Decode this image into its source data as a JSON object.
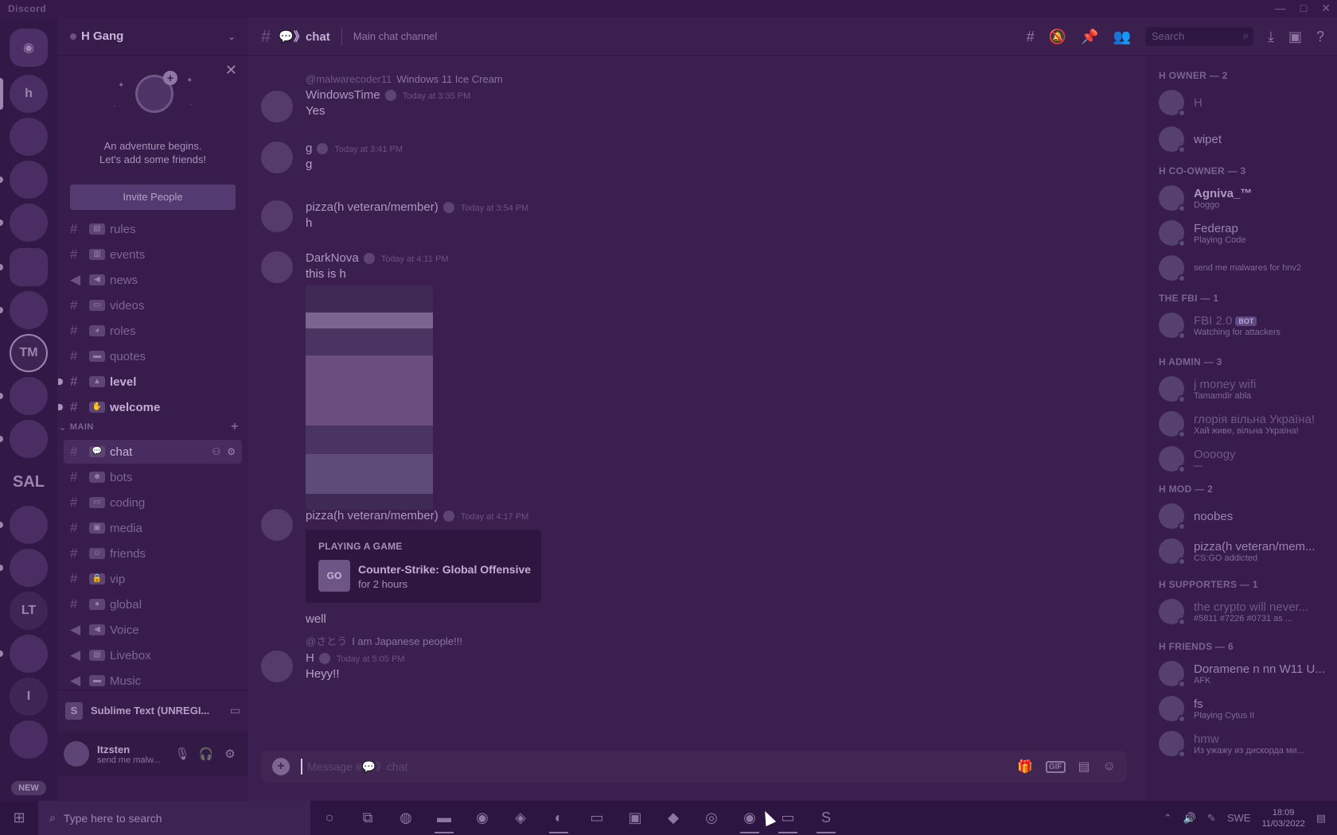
{
  "window": {
    "title": "Discord",
    "controls": [
      "—",
      "□",
      "✕"
    ]
  },
  "guild": {
    "name": "H Gang"
  },
  "invite_panel": {
    "line1": "An adventure begins.",
    "line2": "Let's add some friends!",
    "button": "Invite People"
  },
  "channels_top": [
    {
      "name": "rules",
      "emoji": "▤"
    },
    {
      "name": "events",
      "emoji": "▥"
    },
    {
      "name": "news",
      "emoji": "◀"
    },
    {
      "name": "videos",
      "emoji": "▭"
    },
    {
      "name": "roles",
      "emoji": "◕"
    },
    {
      "name": "quotes",
      "emoji": "▬"
    },
    {
      "name": "level",
      "emoji": "▲"
    },
    {
      "name": "welcome",
      "emoji": "✋"
    }
  ],
  "category_main": "MAIN",
  "channels_main": [
    {
      "name": "chat",
      "emoji": "💬"
    },
    {
      "name": "bots",
      "emoji": "☻"
    },
    {
      "name": "coding",
      "emoji": "▭"
    },
    {
      "name": "media",
      "emoji": "▣"
    },
    {
      "name": "friends",
      "emoji": "☺"
    },
    {
      "name": "vip",
      "emoji": "🔒"
    },
    {
      "name": "global",
      "emoji": "●"
    },
    {
      "name": "Voice",
      "emoji": "◀"
    },
    {
      "name": "Livebox",
      "emoji": "▤"
    },
    {
      "name": "Music",
      "emoji": "▬"
    }
  ],
  "activity_bar": {
    "app": "Sublime Text (UNREGI..."
  },
  "user": {
    "name": "Itzsten",
    "status": "send me malw..."
  },
  "header": {
    "channel": "chat",
    "topic": "Main chat channel",
    "search_placeholder": "Search"
  },
  "messages": {
    "m1": {
      "reply_user": "@malwarecoder11",
      "reply_text": "Windows 11 Ice Cream",
      "author": "WindowsTime",
      "time": "Today at 3:35 PM",
      "text": "Yes"
    },
    "m2": {
      "author": "g",
      "time": "Today at 3:41 PM",
      "text": "g"
    },
    "m3": {
      "author": "pizza(h veteran/member)",
      "time": "Today at 3:54 PM",
      "text": "h"
    },
    "m4": {
      "author": "DarkNova",
      "time": "Today at 4:11 PM",
      "text": "this is h"
    },
    "m5": {
      "author": "pizza(h veteran/member)",
      "time": "Today at 4:17 PM",
      "card_kicker": "PLAYING A GAME",
      "card_game": "Counter-Strike: Global Offensive",
      "card_duration": "for 2 hours",
      "card_icon": "GO",
      "text": "well"
    },
    "m6": {
      "reply_user": "@さとう",
      "reply_text": "I am Japanese people!!!",
      "author": "H",
      "time": "Today at 5:05 PM",
      "text": "Heyy!!"
    }
  },
  "composer": {
    "placeholder": "Message #💬》chat"
  },
  "members": {
    "owner": {
      "header": "H OWNER — 2",
      "list": [
        {
          "name": "H",
          "sub": ""
        },
        {
          "name": "wipet",
          "sub": ""
        }
      ]
    },
    "coowner": {
      "header": "H CO-OWNER — 3",
      "list": [
        {
          "name": "Agniva_™",
          "sub": "Doggo"
        },
        {
          "name": "Federap",
          "sub": "Playing Code"
        },
        {
          "name": "",
          "sub": "send me malwares for hnv2"
        }
      ]
    },
    "fbi": {
      "header": "THE FBI — 1",
      "list": [
        {
          "name": "FBI 2.0",
          "bot": "BOT",
          "sub": "Watching for attackers"
        }
      ]
    },
    "admin": {
      "header": "H ADMIN — 3",
      "list": [
        {
          "name": "j money wifi",
          "sub": "Tamamdir abla"
        },
        {
          "name": "глорія вільна Україна!",
          "sub": "Хай живе, вільна Україна!"
        },
        {
          "name": "Oooogy",
          "sub": "—"
        }
      ]
    },
    "mod": {
      "header": "H MOD — 2",
      "list": [
        {
          "name": "noobes",
          "sub": ""
        },
        {
          "name": "pizza(h veteran/mem...",
          "sub": "CS:GO addicted"
        }
      ]
    },
    "supporters": {
      "header": "H SUPPORTERS — 1",
      "list": [
        {
          "name": "the crypto will never...",
          "sub": "#5811 #7226 #0731 as ..."
        }
      ]
    },
    "friends": {
      "header": "H FRIENDS — 6",
      "list": [
        {
          "name": "Doramene n nn W11 U...",
          "sub": "AFK"
        },
        {
          "name": "fs",
          "sub": "Playing Cytus II"
        },
        {
          "name": "hmw",
          "sub": "Из ужажу из дискорда ми..."
        }
      ]
    }
  },
  "taskbar": {
    "search_placeholder": "Type here to search",
    "lang": "SWE",
    "time": "18:09",
    "date": "11/03/2022"
  },
  "servers": {
    "tm": "TM",
    "sal": "SAL",
    "lt": "LT",
    "i": "I",
    "new": "NEW"
  }
}
